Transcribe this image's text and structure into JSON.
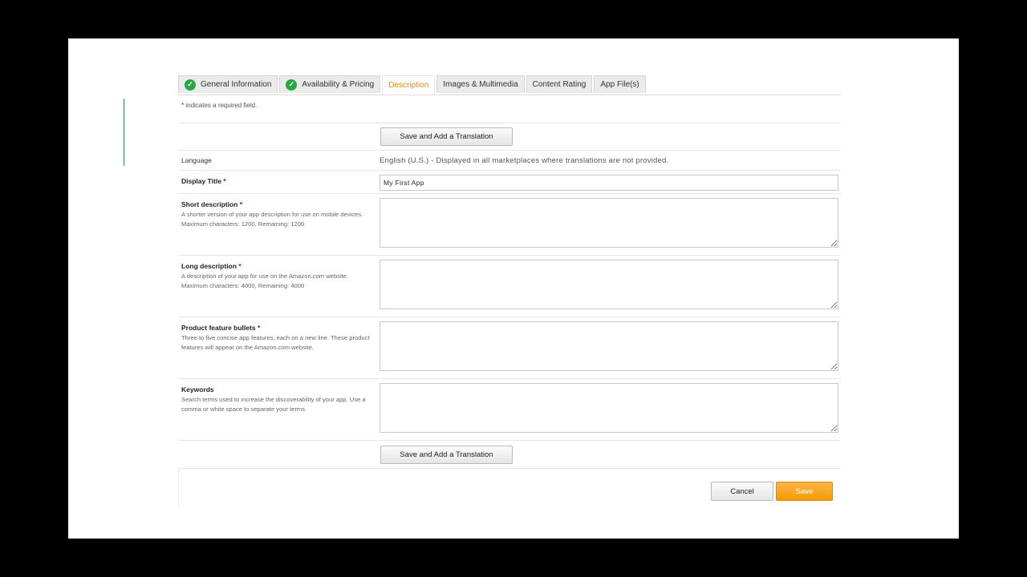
{
  "tabs": [
    {
      "label": "General Information",
      "complete": true,
      "active": false
    },
    {
      "label": "Availability & Pricing",
      "complete": true,
      "active": false
    },
    {
      "label": "Description",
      "complete": false,
      "active": true
    },
    {
      "label": "Images & Multimedia",
      "complete": false,
      "active": false
    },
    {
      "label": "Content Rating",
      "complete": false,
      "active": false
    },
    {
      "label": "App File(s)",
      "complete": false,
      "active": false
    }
  ],
  "required_note": {
    "star": "*",
    "text": " indicates a required field."
  },
  "buttons": {
    "save_translation_top": "Save and Add a Translation",
    "save_translation_bottom": "Save and Add a Translation",
    "cancel": "Cancel",
    "save": "Save"
  },
  "fields": {
    "language": {
      "label": "Language",
      "value": "English (U.S.) - Displayed in all marketplaces where translations are not provided."
    },
    "display_title": {
      "label": "Display Title",
      "star": "*",
      "value": "My First App"
    },
    "short_description": {
      "label": "Short description",
      "star": "*",
      "help": "A shorter version of your app description for use on mobile devices.",
      "limit": "Maximum characters: 1200, Remaining: 1200",
      "value": ""
    },
    "long_description": {
      "label": "Long description",
      "star": "*",
      "help": "A description of your app for use on the Amazon.com website.",
      "limit": "Maximum characters: 4000, Remaining: 4000",
      "value": ""
    },
    "feature_bullets": {
      "label": "Product feature bullets",
      "star": "*",
      "help": "Three to five concise app features, each on a new line. These product features will appear on the Amazon.com website.",
      "value": ""
    },
    "keywords": {
      "label": "Keywords",
      "help": "Search terms used to increase the discoverability of your app. Use a comma or white space to separate your terms",
      "value": ""
    }
  },
  "colors": {
    "accent": "#f08804",
    "check": "#27a844",
    "primary_button": "#f59c00"
  }
}
